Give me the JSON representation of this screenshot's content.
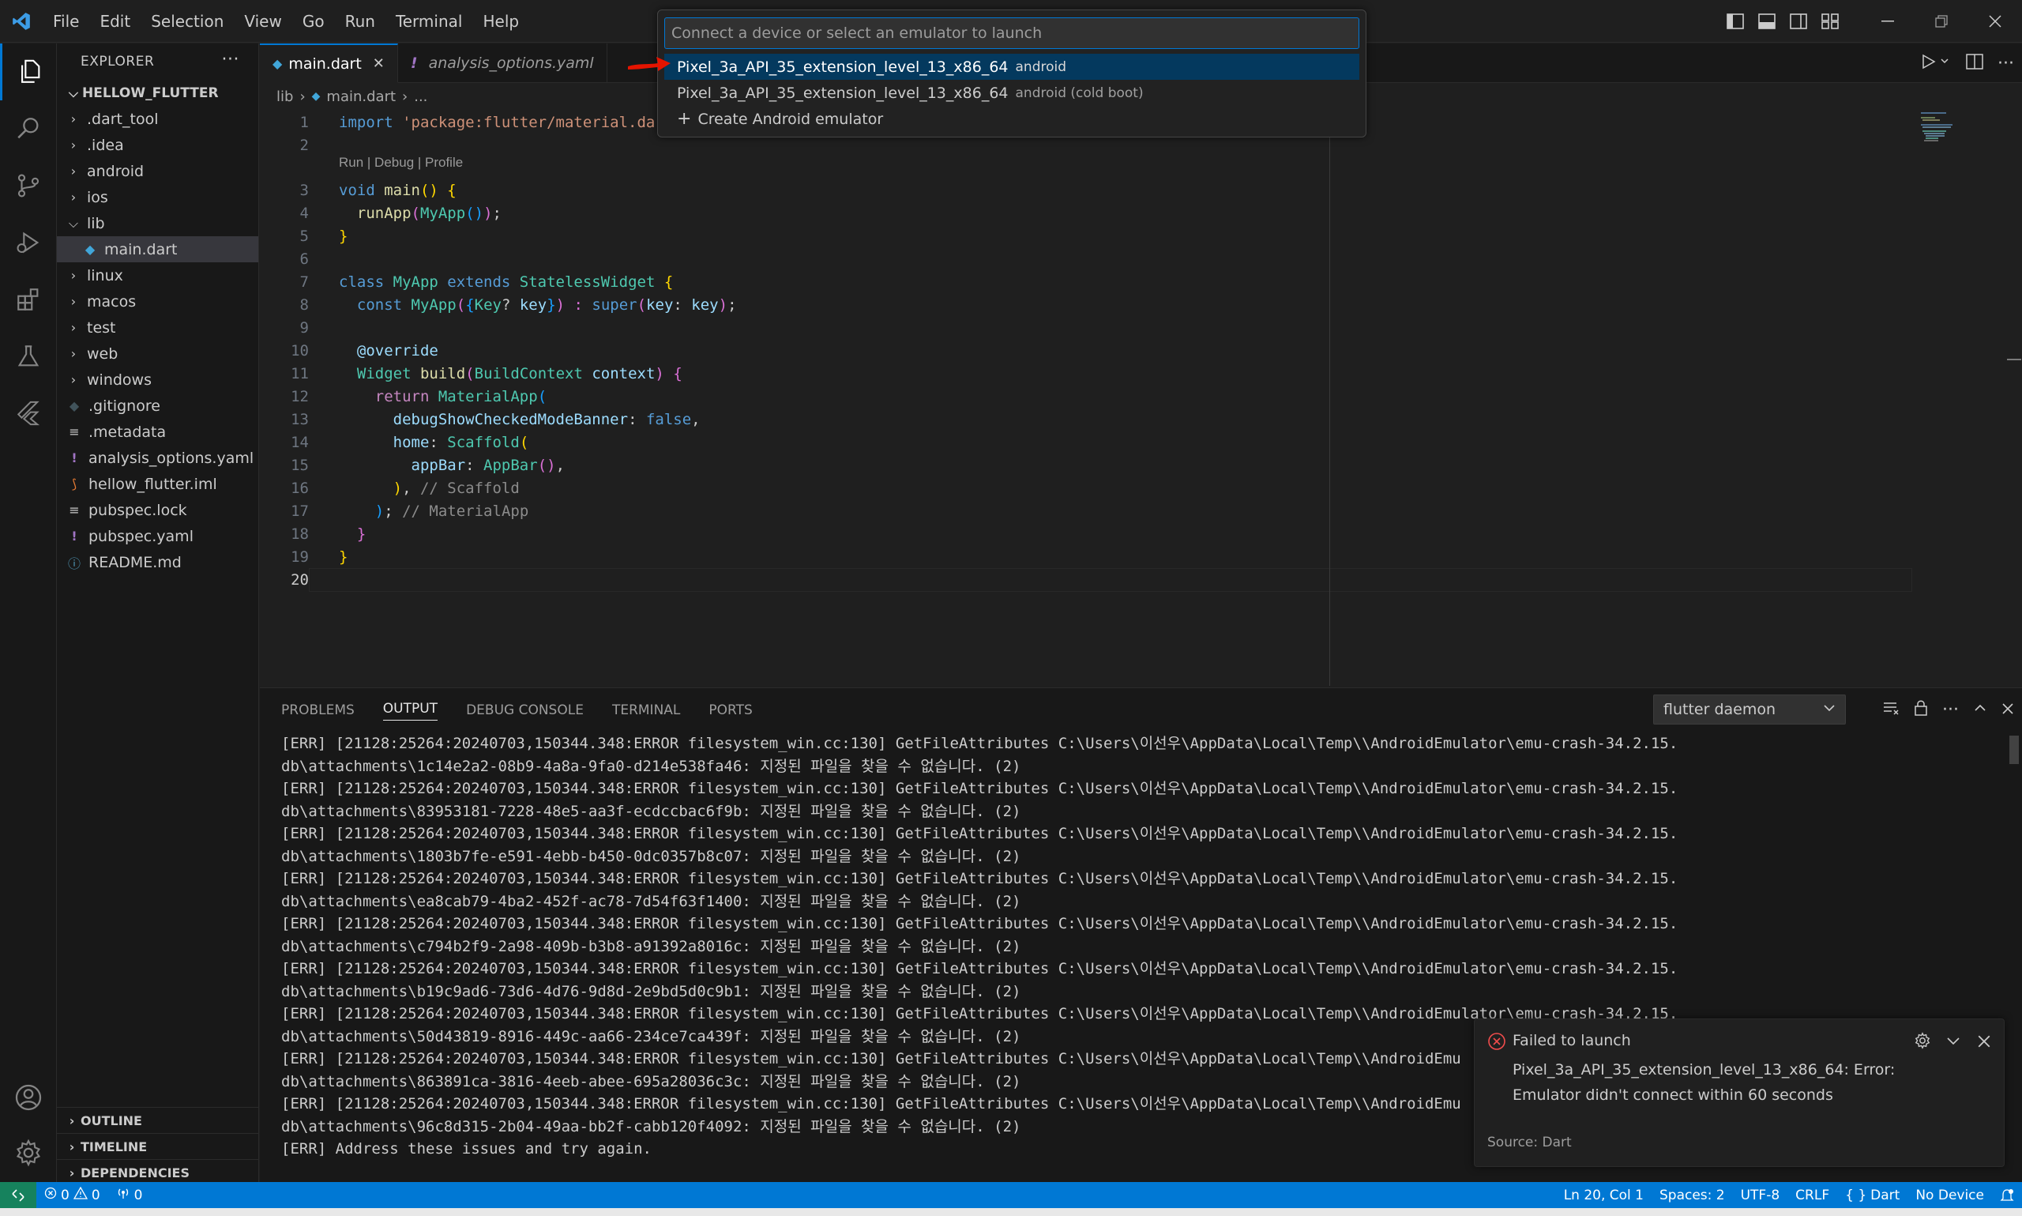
{
  "menu": [
    "File",
    "Edit",
    "Selection",
    "View",
    "Go",
    "Run",
    "Terminal",
    "Help"
  ],
  "explorer": {
    "title": "EXPLORER",
    "more": "···",
    "project": "HELLOW_FLUTTER",
    "items": [
      {
        "label": ".dart_tool",
        "type": "folder",
        "open": false,
        "depth": 1
      },
      {
        "label": ".idea",
        "type": "folder",
        "open": false,
        "depth": 1
      },
      {
        "label": "android",
        "type": "folder",
        "open": false,
        "depth": 1
      },
      {
        "label": "ios",
        "type": "folder",
        "open": false,
        "depth": 1
      },
      {
        "label": "lib",
        "type": "folder",
        "open": true,
        "depth": 1
      },
      {
        "label": "main.dart",
        "type": "dart",
        "depth": 2,
        "selected": true
      },
      {
        "label": "linux",
        "type": "folder",
        "open": false,
        "depth": 1
      },
      {
        "label": "macos",
        "type": "folder",
        "open": false,
        "depth": 1
      },
      {
        "label": "test",
        "type": "folder",
        "open": false,
        "depth": 1
      },
      {
        "label": "web",
        "type": "folder",
        "open": false,
        "depth": 1
      },
      {
        "label": "windows",
        "type": "folder",
        "open": false,
        "depth": 1
      },
      {
        "label": ".gitignore",
        "type": "git",
        "depth": 1
      },
      {
        "label": ".metadata",
        "type": "lines",
        "depth": 1
      },
      {
        "label": "analysis_options.yaml",
        "type": "yaml",
        "depth": 1
      },
      {
        "label": "hellow_flutter.iml",
        "type": "rss",
        "depth": 1
      },
      {
        "label": "pubspec.lock",
        "type": "lines",
        "depth": 1
      },
      {
        "label": "pubspec.yaml",
        "type": "yaml",
        "depth": 1
      },
      {
        "label": "README.md",
        "type": "info",
        "depth": 1
      }
    ],
    "bottom": [
      "OUTLINE",
      "TIMELINE",
      "DEPENDENCIES"
    ]
  },
  "tabs": [
    {
      "label": "main.dart",
      "active": true
    },
    {
      "label": "analysis_options.yaml",
      "active": false
    }
  ],
  "breadcrumb": [
    "lib",
    "main.dart",
    "..."
  ],
  "codelens": "Run | Debug | Profile",
  "code": [
    {
      "n": "1",
      "tokens": [
        [
          "import ",
          "k"
        ],
        [
          "'package:flutter/material.da",
          "s"
        ]
      ]
    },
    {
      "n": "2",
      "tokens": []
    },
    {
      "n": "3",
      "tokens": [
        [
          "void ",
          "k"
        ],
        [
          "main",
          "f"
        ],
        [
          "() ",
          "y"
        ],
        [
          "{",
          "y"
        ]
      ]
    },
    {
      "n": "4",
      "tokens": [
        [
          "  ",
          "p"
        ],
        [
          "runApp",
          "f"
        ],
        [
          "(",
          "pk"
        ],
        [
          "MyApp",
          "t"
        ],
        [
          "()",
          "bl"
        ],
        [
          ")",
          "pk"
        ],
        [
          ";",
          "p"
        ]
      ]
    },
    {
      "n": "5",
      "tokens": [
        [
          "}",
          "y"
        ]
      ]
    },
    {
      "n": "6",
      "tokens": []
    },
    {
      "n": "7",
      "tokens": [
        [
          "class ",
          "k"
        ],
        [
          "MyApp ",
          "t"
        ],
        [
          "extends ",
          "k"
        ],
        [
          "StatelessWidget ",
          "t"
        ],
        [
          "{",
          "y"
        ]
      ]
    },
    {
      "n": "8",
      "tokens": [
        [
          "  ",
          "p"
        ],
        [
          "const ",
          "k"
        ],
        [
          "MyApp",
          "t"
        ],
        [
          "(",
          "pk"
        ],
        [
          "{",
          "bl"
        ],
        [
          "Key",
          "t"
        ],
        [
          "? ",
          "p"
        ],
        [
          "key",
          "v"
        ],
        [
          "}",
          "bl"
        ],
        [
          ") : ",
          "pk"
        ],
        [
          "super",
          "k"
        ],
        [
          "(",
          "pk"
        ],
        [
          "key",
          "v"
        ],
        [
          ": ",
          "p"
        ],
        [
          "key",
          "v"
        ],
        [
          ")",
          "pk"
        ],
        [
          ";",
          "p"
        ]
      ]
    },
    {
      "n": "9",
      "tokens": []
    },
    {
      "n": "10",
      "tokens": [
        [
          "  ",
          "p"
        ],
        [
          "@override",
          "v"
        ]
      ]
    },
    {
      "n": "11",
      "tokens": [
        [
          "  ",
          "p"
        ],
        [
          "Widget ",
          "t"
        ],
        [
          "build",
          "f"
        ],
        [
          "(",
          "pk"
        ],
        [
          "BuildContext ",
          "t"
        ],
        [
          "context",
          "v"
        ],
        [
          ") ",
          "pk"
        ],
        [
          "{",
          "pk"
        ]
      ]
    },
    {
      "n": "12",
      "tokens": [
        [
          "    ",
          "p"
        ],
        [
          "return ",
          "kc"
        ],
        [
          "MaterialApp",
          "t"
        ],
        [
          "(",
          "bl"
        ]
      ]
    },
    {
      "n": "13",
      "tokens": [
        [
          "      ",
          "p"
        ],
        [
          "debugShowCheckedModeBanner",
          "v"
        ],
        [
          ": ",
          "p"
        ],
        [
          "false",
          "k"
        ],
        [
          ",",
          "p"
        ]
      ]
    },
    {
      "n": "14",
      "tokens": [
        [
          "      ",
          "p"
        ],
        [
          "home",
          "v"
        ],
        [
          ": ",
          "p"
        ],
        [
          "Scaffold",
          "t"
        ],
        [
          "(",
          "y"
        ]
      ]
    },
    {
      "n": "15",
      "tokens": [
        [
          "        ",
          "p"
        ],
        [
          "appBar",
          "v"
        ],
        [
          ": ",
          "p"
        ],
        [
          "AppBar",
          "t"
        ],
        [
          "()",
          "pk"
        ],
        [
          ",",
          "p"
        ]
      ]
    },
    {
      "n": "16",
      "tokens": [
        [
          "      ",
          "p"
        ],
        [
          ")",
          "y"
        ],
        [
          ", ",
          "p"
        ],
        [
          "// Scaffold",
          "cm"
        ]
      ]
    },
    {
      "n": "17",
      "tokens": [
        [
          "    ",
          "p"
        ],
        [
          ")",
          "bl"
        ],
        [
          "; ",
          "p"
        ],
        [
          "// MaterialApp",
          "cm"
        ]
      ]
    },
    {
      "n": "18",
      "tokens": [
        [
          "  ",
          "p"
        ],
        [
          "}",
          "pk"
        ]
      ]
    },
    {
      "n": "19",
      "tokens": [
        [
          "}",
          "y"
        ]
      ]
    },
    {
      "n": "20",
      "tokens": [],
      "current": true
    }
  ],
  "quickpick": {
    "placeholder": "Connect a device or select an emulator to launch",
    "items": [
      {
        "label": "Pixel_3a_API_35_extension_level_13_x86_64",
        "desc": "android",
        "selected": true
      },
      {
        "label": "Pixel_3a_API_35_extension_level_13_x86_64",
        "desc": "android (cold boot)",
        "selected": false
      },
      {
        "label": "Create Android emulator",
        "desc": "",
        "selected": false,
        "icon": "plus"
      }
    ]
  },
  "panel": {
    "tabs": [
      "PROBLEMS",
      "OUTPUT",
      "DEBUG CONSOLE",
      "TERMINAL",
      "PORTS"
    ],
    "active_tab": "OUTPUT",
    "channel": "flutter daemon",
    "lines": [
      "[ERR] [21128:25264:20240703,150344.348:ERROR filesystem_win.cc:130] GetFileAttributes C:\\Users\\이선우\\AppData\\Local\\Temp\\\\AndroidEmulator\\emu-crash-34.2.15.",
      "db\\attachments\\1c14e2a2-08b9-4a8a-9fa0-d214e538fa46: 지정된 파일을 찾을 수 없습니다. (2)",
      "[ERR] [21128:25264:20240703,150344.348:ERROR filesystem_win.cc:130] GetFileAttributes C:\\Users\\이선우\\AppData\\Local\\Temp\\\\AndroidEmulator\\emu-crash-34.2.15.",
      "db\\attachments\\83953181-7228-48e5-aa3f-ecdccbac6f9b: 지정된 파일을 찾을 수 없습니다. (2)",
      "[ERR] [21128:25264:20240703,150344.348:ERROR filesystem_win.cc:130] GetFileAttributes C:\\Users\\이선우\\AppData\\Local\\Temp\\\\AndroidEmulator\\emu-crash-34.2.15.",
      "db\\attachments\\1803b7fe-e591-4ebb-b450-0dc0357b8c07: 지정된 파일을 찾을 수 없습니다. (2)",
      "[ERR] [21128:25264:20240703,150344.348:ERROR filesystem_win.cc:130] GetFileAttributes C:\\Users\\이선우\\AppData\\Local\\Temp\\\\AndroidEmulator\\emu-crash-34.2.15.",
      "db\\attachments\\ea8cab79-4ba2-452f-ac78-7d54f63f1400: 지정된 파일을 찾을 수 없습니다. (2)",
      "[ERR] [21128:25264:20240703,150344.348:ERROR filesystem_win.cc:130] GetFileAttributes C:\\Users\\이선우\\AppData\\Local\\Temp\\\\AndroidEmulator\\emu-crash-34.2.15.",
      "db\\attachments\\c794b2f9-2a98-409b-b3b8-a91392a8016c: 지정된 파일을 찾을 수 없습니다. (2)",
      "[ERR] [21128:25264:20240703,150344.348:ERROR filesystem_win.cc:130] GetFileAttributes C:\\Users\\이선우\\AppData\\Local\\Temp\\\\AndroidEmulator\\emu-crash-34.2.15.",
      "db\\attachments\\b19c9ad6-73d6-4d76-9d8d-2e9bd5d0c9b1: 지정된 파일을 찾을 수 없습니다. (2)",
      "[ERR] [21128:25264:20240703,150344.348:ERROR filesystem_win.cc:130] GetFileAttributes C:\\Users\\이선우\\AppData\\Local\\Temp\\\\AndroidEmulator\\emu-crash-34.2.15.",
      "db\\attachments\\50d43819-8916-449c-aa66-234ce7ca439f: 지정된 파일을 찾을 수 없습니다. (2)",
      "[ERR] [21128:25264:20240703,150344.348:ERROR filesystem_win.cc:130] GetFileAttributes C:\\Users\\이선우\\AppData\\Local\\Temp\\\\AndroidEmu",
      "db\\attachments\\863891ca-3816-4eeb-abee-695a28036c3c: 지정된 파일을 찾을 수 없습니다. (2)",
      "[ERR] [21128:25264:20240703,150344.348:ERROR filesystem_win.cc:130] GetFileAttributes C:\\Users\\이선우\\AppData\\Local\\Temp\\\\AndroidEmu",
      "db\\attachments\\96c8d315-2b04-49aa-bb2f-cabb120f4092: 지정된 파일을 찾을 수 없습니다. (2)",
      "[ERR] Address these issues and try again."
    ]
  },
  "notification": {
    "title": "Failed to launch",
    "message_line1": "Pixel_3a_API_35_extension_level_13_x86_64: Error:",
    "message_line2": "Emulator didn't connect within 60 seconds",
    "source": "Source: Dart"
  },
  "status": {
    "errors": "0",
    "warnings": "0",
    "ports": "0",
    "position": "Ln 20, Col 1",
    "spaces": "Spaces: 2",
    "encoding": "UTF-8",
    "eol": "CRLF",
    "language": "Dart",
    "language_glyph": "{ }",
    "device": "No Device"
  },
  "colors": {
    "accent": "#0078d4",
    "statusbar": "#0078d4",
    "remote": "#16825d",
    "error": "#f14c4c",
    "arrow": "#e51400"
  }
}
